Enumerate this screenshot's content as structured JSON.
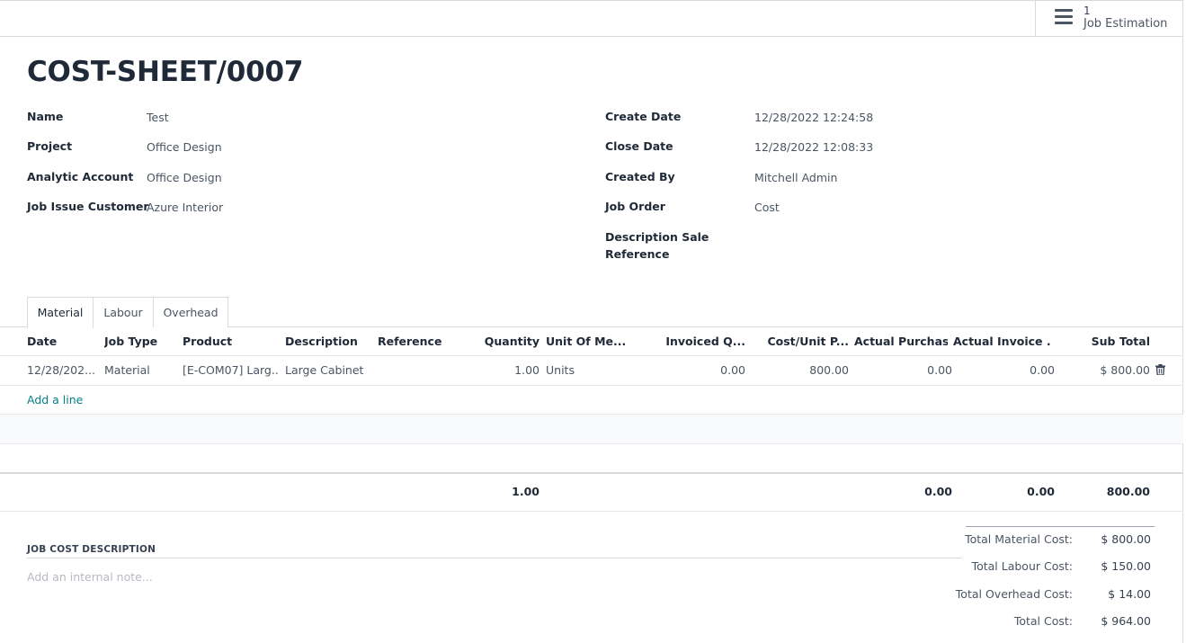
{
  "smart_button": {
    "count": "1",
    "label": "Job Estimation",
    "icon": "list-icon"
  },
  "title": "COST-SHEET/0007",
  "left_fields": [
    {
      "label": "Name",
      "value": "Test"
    },
    {
      "label": "Project",
      "value": "Office Design"
    },
    {
      "label": "Analytic Account",
      "value": "Office Design"
    },
    {
      "label": "Job Issue Customer",
      "value": "Azure Interior"
    }
  ],
  "right_fields": [
    {
      "label": "Create Date",
      "value": "12/28/2022 12:24:58"
    },
    {
      "label": "Close Date",
      "value": "12/28/2022 12:08:33"
    },
    {
      "label": "Created By",
      "value": "Mitchell Admin"
    },
    {
      "label": "Job Order",
      "value": "Cost"
    },
    {
      "label_line1": "Description Sale",
      "label_line2": "Reference",
      "value": ""
    }
  ],
  "tabs": [
    "Material",
    "Labour",
    "Overhead"
  ],
  "table": {
    "columns": [
      "Date",
      "Job Type",
      "Product",
      "Description",
      "Reference",
      "Quantity",
      "Unit Of Me...",
      "Invoiced Q...",
      "Cost/Unit P...",
      "Actual Purchas...",
      "Actual Invoice ...",
      "Sub Total"
    ],
    "row": {
      "date": "12/28/202...",
      "job_type": "Material",
      "product": "[E-COM07] Larg...",
      "description": "Large Cabinet",
      "reference": "",
      "quantity": "1.00",
      "uom": "Units",
      "invoiced_qty": "0.00",
      "cost_unit": "800.00",
      "actual_purchase": "0.00",
      "actual_invoice": "0.00",
      "subtotal": "$ 800.00"
    },
    "add_line": "Add a line",
    "totals": {
      "quantity": "1.00",
      "actual_purchase": "0.00",
      "actual_invoice": "0.00",
      "subtotal": "800.00"
    }
  },
  "notes": {
    "title": "JOB COST DESCRIPTION",
    "placeholder": "Add an internal note..."
  },
  "summary": [
    {
      "label": "Total Material Cost:",
      "value": "$ 800.00"
    },
    {
      "label": "Total Labour Cost:",
      "value": "$ 150.00"
    },
    {
      "label": "Total Overhead Cost:",
      "value": "$ 14.00"
    },
    {
      "label": "Total Cost:",
      "value": "$ 964.00"
    }
  ]
}
